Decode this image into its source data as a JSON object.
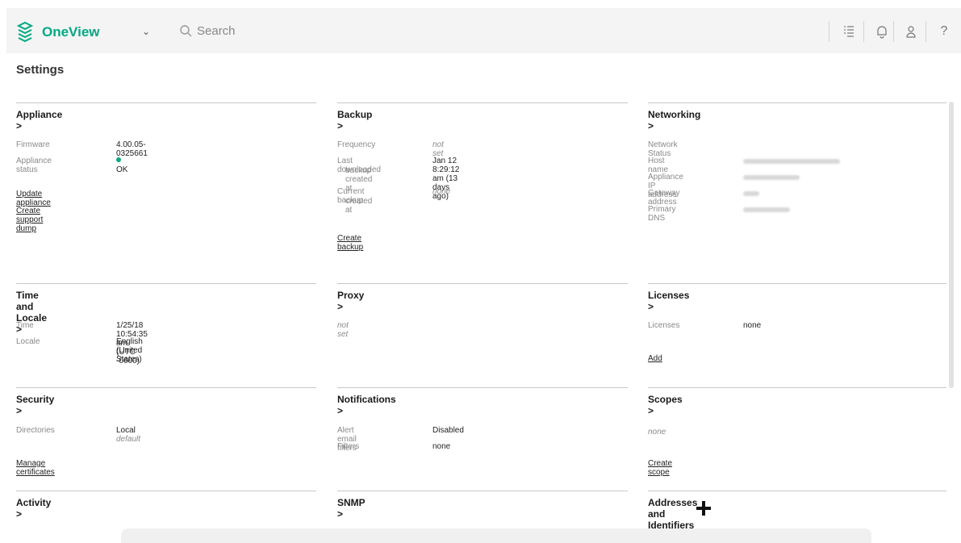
{
  "header": {
    "app_name": "OneView",
    "search_placeholder": "Search",
    "icons": [
      "activity-list-icon",
      "bell-icon",
      "user-icon",
      "help-icon"
    ],
    "help_glyph": "?"
  },
  "page_title": "Settings",
  "colors": {
    "accent": "#01a982",
    "rule": "#c8c8c8",
    "label": "#8a8a8a"
  },
  "panels": {
    "appliance": {
      "title": "Appliance >",
      "firmware_label": "Firmware",
      "firmware_value": "4.00.05-0325661",
      "status_label": "Appliance status",
      "status_value": "OK",
      "update_link": "Update appliance",
      "support_link": "Create support dump"
    },
    "backup": {
      "title": "Backup >",
      "frequency_label": "Frequency",
      "frequency_value": "not set",
      "last_downloaded_label_1": "Last downloaded",
      "last_downloaded_label_2": "backup created at",
      "last_downloaded_value": "Jan 12 8:29:12 am (13 days ago)",
      "current_label_1": "Current backup",
      "current_label_2": "created at",
      "current_value": "none",
      "create_link": "Create backup"
    },
    "networking": {
      "title": "Networking >",
      "network_status_label": "Network Status",
      "host_name_label": "Host name",
      "ip_label": "Appliance IP address",
      "gateway_label": "Gateway address",
      "dns_label": "Primary DNS"
    },
    "time_locale": {
      "title": "Time and Locale >",
      "time_label": "Time",
      "time_value": "1/25/18 10:54:35 am (UTC -0600)",
      "locale_label": "Locale",
      "locale_value": "English (United States)"
    },
    "proxy": {
      "title": "Proxy >",
      "value": "not set"
    },
    "licenses": {
      "title": "Licenses >",
      "licenses_label": "Licenses",
      "licenses_value": "none",
      "add_link": "Add"
    },
    "security": {
      "title": "Security >",
      "directories_label": "Directories",
      "directories_value_bold": "Local",
      "directories_value_rest": " default",
      "certificates_link": "Manage certificates"
    },
    "notifications": {
      "title": "Notifications >",
      "alert_label": "Alert email filters",
      "alert_value": "Disabled",
      "filters_label": "Filters",
      "filters_value": "none"
    },
    "scopes": {
      "title": "Scopes >",
      "value": "none",
      "create_link": "Create scope"
    },
    "activity": {
      "title": "Activity >"
    },
    "snmp": {
      "title": "SNMP >"
    },
    "addresses": {
      "title": "Addresses and Identifiers >"
    }
  }
}
